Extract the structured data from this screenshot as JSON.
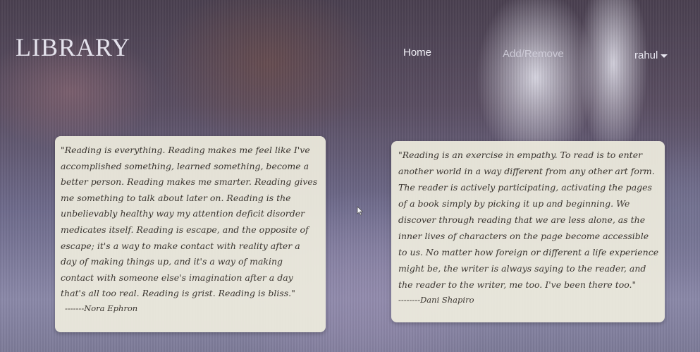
{
  "navbar": {
    "brand": "LIBRARY",
    "links": {
      "home": "Home",
      "add_remove": "Add/Remove",
      "user": "rahul"
    }
  },
  "quotes": [
    {
      "text": "\"Reading is everything. Reading makes me feel like I've accomplished something, learned something, become a better person. Reading makes me smarter. Reading gives me something to talk about later on. Reading is the unbelievably healthy way my attention deficit disorder medicates itself. Reading is escape, and the opposite of escape; it's a way to make contact with reality after a day of making things up, and it's a way of making contact with someone else's imagination after a day that's all too real. Reading is grist. Reading is bliss.\"",
      "author": "-------Nora Ephron"
    },
    {
      "text": "\"Reading is an exercise in empathy. To read is to enter another world in a way different from any other art form. The reader is actively participating, activating the pages of a book simply by picking it up and beginning. We discover through reading that we are less alone, as the inner lives of characters on the page become accessible to us. No matter how foreign or different a life experience might be, the writer is always saying to the reader, and the reader to the writer, me too. I've been there too.\"",
      "author": "--------Dani Shapiro"
    }
  ],
  "icons": {
    "user_menu": "caret-down-icon",
    "pointer": "mouse-cursor-icon"
  },
  "colors": {
    "card_background": "#eeecde",
    "nav_text": "#f1f0f6",
    "brand_text": "#e4e2ec"
  }
}
